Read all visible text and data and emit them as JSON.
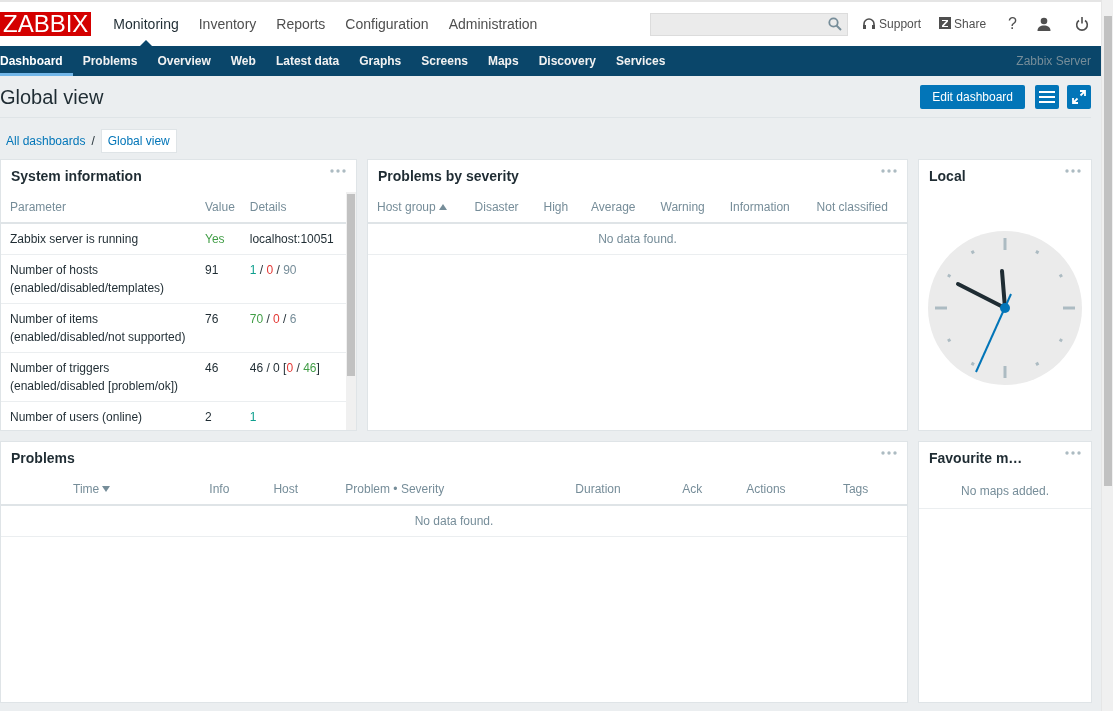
{
  "header": {
    "logo": "ZABBIX",
    "main_menu": [
      {
        "label": "Monitoring",
        "selected": true
      },
      {
        "label": "Inventory",
        "selected": false
      },
      {
        "label": "Reports",
        "selected": false
      },
      {
        "label": "Configuration",
        "selected": false
      },
      {
        "label": "Administration",
        "selected": false
      }
    ],
    "links": [
      {
        "kind": "support",
        "label": "Support"
      },
      {
        "kind": "share",
        "label": "Share"
      },
      {
        "kind": "help",
        "label": "?"
      },
      {
        "kind": "user"
      },
      {
        "kind": "logout"
      }
    ]
  },
  "sub_menu": [
    {
      "label": "Dashboard",
      "selected": true
    },
    {
      "label": "Problems",
      "selected": false
    },
    {
      "label": "Overview",
      "selected": false
    },
    {
      "label": "Web",
      "selected": false
    },
    {
      "label": "Latest data",
      "selected": false
    },
    {
      "label": "Graphs",
      "selected": false
    },
    {
      "label": "Screens",
      "selected": false
    },
    {
      "label": "Maps",
      "selected": false
    },
    {
      "label": "Discovery",
      "selected": false
    },
    {
      "label": "Services",
      "selected": false
    }
  ],
  "server_name": "Zabbix Server",
  "page_title": "Global view",
  "edit_button": "Edit dashboard",
  "breadcrumb_separator": "/",
  "breadcrumbs": [
    {
      "label": "All dashboards",
      "selected": false
    },
    {
      "label": "Global view",
      "selected": true
    }
  ],
  "system_information": {
    "title": "System information",
    "columns": [
      "Parameter",
      "Value",
      "Details"
    ],
    "rows": [
      {
        "parameter": "Zabbix server is running",
        "value": {
          "text": "Yes",
          "color": "#429e47"
        },
        "details": [
          {
            "text": "localhost:10051"
          }
        ]
      },
      {
        "parameter": "Number of hosts (enabled/disabled/templates)",
        "value": {
          "text": "91"
        },
        "details": [
          {
            "text": "1",
            "color": "#0e9f8e"
          },
          {
            "text": " / "
          },
          {
            "text": "0",
            "color": "#e33734"
          },
          {
            "text": " / "
          },
          {
            "text": "90",
            "color": "#768d99"
          }
        ]
      },
      {
        "parameter": "Number of items (enabled/disabled/not supported)",
        "value": {
          "text": "76"
        },
        "details": [
          {
            "text": "70",
            "color": "#429e47"
          },
          {
            "text": " / "
          },
          {
            "text": "0",
            "color": "#e33734"
          },
          {
            "text": " / "
          },
          {
            "text": "6",
            "color": "#768d99"
          }
        ]
      },
      {
        "parameter": "Number of triggers (enabled/disabled [problem/ok])",
        "value": {
          "text": "46"
        },
        "details": [
          {
            "text": "46 / 0 ["
          },
          {
            "text": "0",
            "color": "#e33734"
          },
          {
            "text": " / "
          },
          {
            "text": "46",
            "color": "#429e47"
          },
          {
            "text": "]"
          }
        ]
      },
      {
        "parameter": "Number of users (online)",
        "value": {
          "text": "2"
        },
        "details": [
          {
            "text": "1",
            "color": "#0e9f8e"
          }
        ]
      }
    ]
  },
  "problems_by_severity": {
    "title": "Problems by severity",
    "columns": [
      {
        "label": "Host group",
        "sorted": true,
        "descending": false
      },
      {
        "label": "Disaster"
      },
      {
        "label": "High"
      },
      {
        "label": "Average"
      },
      {
        "label": "Warning"
      },
      {
        "label": "Information"
      },
      {
        "label": "Not classified"
      }
    ],
    "empty": "No data found."
  },
  "clock": {
    "title": "Local"
  },
  "problems": {
    "title": "Problems",
    "columns": [
      {
        "label": "Time",
        "sorted": true,
        "descending": true
      },
      {
        "label": "Info"
      },
      {
        "label": "Host"
      },
      {
        "label": "Problem • Severity"
      },
      {
        "label": "Duration"
      },
      {
        "label": "Ack"
      },
      {
        "label": "Actions"
      },
      {
        "label": "Tags"
      }
    ],
    "empty": "No data found."
  },
  "favourite_maps": {
    "title": "Favourite m…",
    "empty": "No maps added."
  }
}
